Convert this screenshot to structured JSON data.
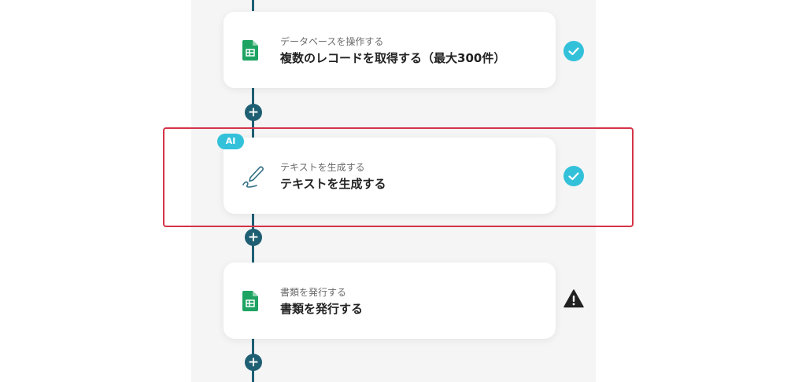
{
  "colors": {
    "connector": "#1f5f73",
    "check": "#33c1da",
    "highlight": "#d43448",
    "sheets_green": "#1ea362"
  },
  "steps": [
    {
      "subtitle": "データベースを操作する",
      "title": "複数のレコードを取得する（最大300件）",
      "icon": "google-sheets-icon",
      "status": "check-circle-icon",
      "badge": ""
    },
    {
      "subtitle": "テキストを生成する",
      "title": "テキストを生成する",
      "icon": "pen-icon",
      "status": "check-circle-icon",
      "badge": "AI"
    },
    {
      "subtitle": "書類を発行する",
      "title": "書類を発行する",
      "icon": "google-sheets-icon",
      "status": "warning-icon",
      "badge": ""
    }
  ],
  "add_step_label": "+"
}
